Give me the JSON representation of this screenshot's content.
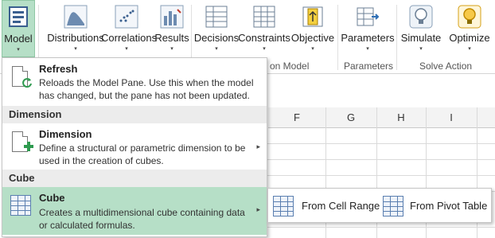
{
  "ribbon": {
    "buttons": [
      {
        "id": "model",
        "label": "Model",
        "icon": "model-icon",
        "arrow": "▾"
      },
      {
        "id": "distributions",
        "label": "Distributions",
        "icon": "distributions-icon",
        "arrow": "▾"
      },
      {
        "id": "correlations",
        "label": "Correlations",
        "icon": "correlations-icon",
        "arrow": "▾"
      },
      {
        "id": "results",
        "label": "Results",
        "icon": "results-icon",
        "arrow": "▾"
      },
      {
        "id": "decisions",
        "label": "Decisions",
        "icon": "decisions-icon",
        "arrow": "▾"
      },
      {
        "id": "constraints",
        "label": "Constraints",
        "icon": "constraints-icon",
        "arrow": "▾"
      },
      {
        "id": "objective",
        "label": "Objective",
        "icon": "objective-icon",
        "arrow": "▾"
      },
      {
        "id": "parameters",
        "label": "Parameters",
        "icon": "parameters-icon",
        "arrow": "▾"
      },
      {
        "id": "simulate",
        "label": "Simulate",
        "icon": "simulate-icon",
        "arrow": "▾"
      },
      {
        "id": "optimize",
        "label": "Optimize",
        "icon": "optimize-icon",
        "arrow": "▾"
      }
    ],
    "groups": {
      "optimization_model_partial": "on Model",
      "parameters": "Parameters",
      "solve_action": "Solve Action"
    }
  },
  "sheet": {
    "columns": [
      "F",
      "G",
      "H",
      "I"
    ]
  },
  "model_menu": {
    "refresh": {
      "title": "Refresh",
      "desc1": "Reloads the Model Pane. Use this when the model",
      "desc2": "has changed, but the pane has not been updated."
    },
    "dimension_header": "Dimension",
    "dimension": {
      "title": "Dimension",
      "desc1": "Define a structural or parametric dimension to be",
      "desc2": "used in the creation of cubes.",
      "submenu_arrow": "▸"
    },
    "cube_header": "Cube",
    "cube": {
      "title": "Cube",
      "desc1": "Creates a multidimensional cube containing data",
      "desc2": "or calculated formulas.",
      "submenu_arrow": "▸"
    }
  },
  "cube_submenu": {
    "from_cell_range": "From Cell Range",
    "from_pivot_table": "From Pivot Table"
  },
  "colors": {
    "active_green": "#b6dfc7",
    "highlight_green": "#b6dfc7"
  }
}
